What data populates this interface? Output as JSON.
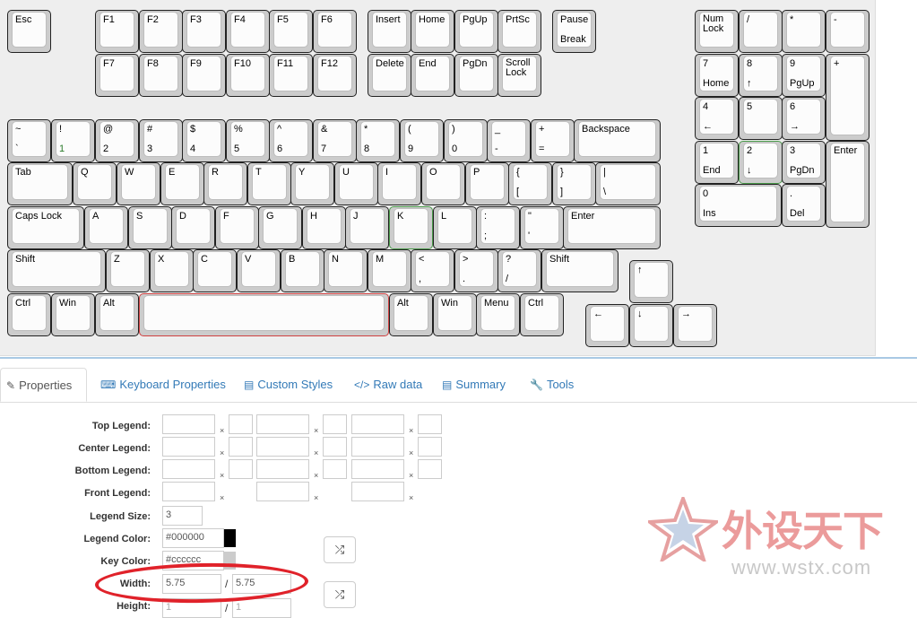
{
  "tabs": [
    {
      "label": "Properties",
      "icon": "edit-icon"
    },
    {
      "label": "Keyboard Properties",
      "icon": "keyboard-icon"
    },
    {
      "label": "Custom Styles",
      "icon": "file-icon"
    },
    {
      "label": "Raw data",
      "icon": "code-icon"
    },
    {
      "label": "Summary",
      "icon": "file-icon"
    },
    {
      "label": "Tools",
      "icon": "wrench-icon"
    }
  ],
  "keys": {
    "esc": {
      "t": "Esc"
    },
    "f1": {
      "t": "F1"
    },
    "f2": {
      "t": "F2"
    },
    "f3": {
      "t": "F3"
    },
    "f4": {
      "t": "F4"
    },
    "f5": {
      "t": "F5"
    },
    "f6": {
      "t": "F6"
    },
    "f7": {
      "t": "F7"
    },
    "f8": {
      "t": "F8"
    },
    "f9": {
      "t": "F9"
    },
    "f10": {
      "t": "F10"
    },
    "f11": {
      "t": "F11"
    },
    "f12": {
      "t": "F12"
    },
    "insert": {
      "t": "Insert"
    },
    "home": {
      "t": "Home"
    },
    "pgup": {
      "t": "PgUp"
    },
    "prtsc": {
      "t": "PrtSc"
    },
    "pause": {
      "t": "Pause",
      "b": "Break"
    },
    "delete": {
      "t": "Delete"
    },
    "end": {
      "t": "End"
    },
    "pgdn": {
      "t": "PgDn"
    },
    "scroll": {
      "t": "Scroll",
      "t2": "Lock"
    },
    "numlock": {
      "t": "Num",
      "t2": "Lock"
    },
    "kp_div": {
      "t": "/"
    },
    "kp_mul": {
      "t": "*"
    },
    "kp_sub": {
      "t": "-"
    },
    "kp7": {
      "t": "7",
      "b": "Home"
    },
    "kp8": {
      "t": "8",
      "b": "↑"
    },
    "kp9": {
      "t": "9",
      "b": "PgUp"
    },
    "kp_add": {
      "t": "+"
    },
    "kp4": {
      "t": "4",
      "b": "←"
    },
    "kp5": {
      "t": "5"
    },
    "kp6": {
      "t": "6",
      "b": "→"
    },
    "kp1": {
      "t": "1",
      "b": "End"
    },
    "kp2": {
      "t": "2",
      "b": "↓"
    },
    "kp3": {
      "t": "3",
      "b": "PgDn"
    },
    "kp_enter": {
      "t": "Enter"
    },
    "kp0": {
      "t": "0",
      "b": "Ins"
    },
    "kp_dot": {
      "t": ".",
      "b": "Del"
    },
    "tilde": {
      "t": "~",
      "b": "`"
    },
    "k1": {
      "t": "!",
      "b": "1"
    },
    "k2": {
      "t": "@",
      "b": "2"
    },
    "k3": {
      "t": "#",
      "b": "3"
    },
    "k4": {
      "t": "$",
      "b": "4"
    },
    "k5": {
      "t": "%",
      "b": "5"
    },
    "k6": {
      "t": "^",
      "b": "6"
    },
    "k7": {
      "t": "&",
      "b": "7"
    },
    "k8": {
      "t": "*",
      "b": "8"
    },
    "k9": {
      "t": "(",
      "b": "9"
    },
    "k0": {
      "t": ")",
      "b": "0"
    },
    "minus": {
      "t": "_",
      "b": "-"
    },
    "equal": {
      "t": "+",
      "b": "="
    },
    "backspace": {
      "t": "Backspace"
    },
    "tab": {
      "t": "Tab"
    },
    "q": {
      "t": "Q"
    },
    "w": {
      "t": "W"
    },
    "e": {
      "t": "E"
    },
    "r": {
      "t": "R"
    },
    "tk": {
      "t": "T"
    },
    "y": {
      "t": "Y"
    },
    "u": {
      "t": "U"
    },
    "i": {
      "t": "I"
    },
    "o": {
      "t": "O"
    },
    "p": {
      "t": "P"
    },
    "lbr": {
      "t": "{",
      "b": "["
    },
    "rbr": {
      "t": "}",
      "b": "]"
    },
    "bsl": {
      "t": "|",
      "b": "\\"
    },
    "caps": {
      "t": "Caps Lock"
    },
    "a": {
      "t": "A"
    },
    "s": {
      "t": "S"
    },
    "d": {
      "t": "D"
    },
    "f": {
      "t": "F"
    },
    "g": {
      "t": "G"
    },
    "h": {
      "t": "H"
    },
    "j": {
      "t": "J"
    },
    "k": {
      "t": "K"
    },
    "l": {
      "t": "L"
    },
    "semi": {
      "t": ":",
      "b": ";"
    },
    "quote": {
      "t": "\"",
      "b": "'"
    },
    "enter": {
      "t": "Enter"
    },
    "lshift": {
      "t": "Shift"
    },
    "z": {
      "t": "Z"
    },
    "x": {
      "t": "X"
    },
    "c": {
      "t": "C"
    },
    "v": {
      "t": "V"
    },
    "bk": {
      "t": "B"
    },
    "n": {
      "t": "N"
    },
    "m": {
      "t": "M"
    },
    "comma": {
      "t": "<",
      "b": ","
    },
    "period": {
      "t": ">",
      "b": "."
    },
    "slash": {
      "t": "?",
      "b": "/"
    },
    "rshift": {
      "t": "Shift"
    },
    "up": {
      "t": "↑"
    },
    "lctrl": {
      "t": "Ctrl"
    },
    "lwin": {
      "t": "Win"
    },
    "lalt": {
      "t": "Alt"
    },
    "space": {
      "t": ""
    },
    "ralt": {
      "t": "Alt"
    },
    "rwin": {
      "t": "Win"
    },
    "menu": {
      "t": "Menu"
    },
    "rctrl": {
      "t": "Ctrl"
    },
    "left": {
      "t": "←"
    },
    "down": {
      "t": "↓"
    },
    "right": {
      "t": "→"
    }
  },
  "properties": {
    "labels": {
      "top_legend": "Top Legend:",
      "center_legend": "Center Legend:",
      "bottom_legend": "Bottom Legend:",
      "front_legend": "Front Legend:",
      "legend_size": "Legend Size:",
      "legend_color": "Legend Color:",
      "key_color": "Key Color:",
      "width": "Width:",
      "height": "Height:"
    },
    "clear_symbol": "×",
    "legend_size_value": "3",
    "legend_color_value": "#000000",
    "legend_color_swatch": "#000000",
    "key_color_value": "#cccccc",
    "key_color_swatch": "#cccccc",
    "width_value": "5.75",
    "width2_value": "5.75",
    "height_value": "1",
    "height2_value": "1",
    "separator": "/"
  },
  "watermark": {
    "text": "外设天下",
    "url": "www.wstx.com"
  }
}
